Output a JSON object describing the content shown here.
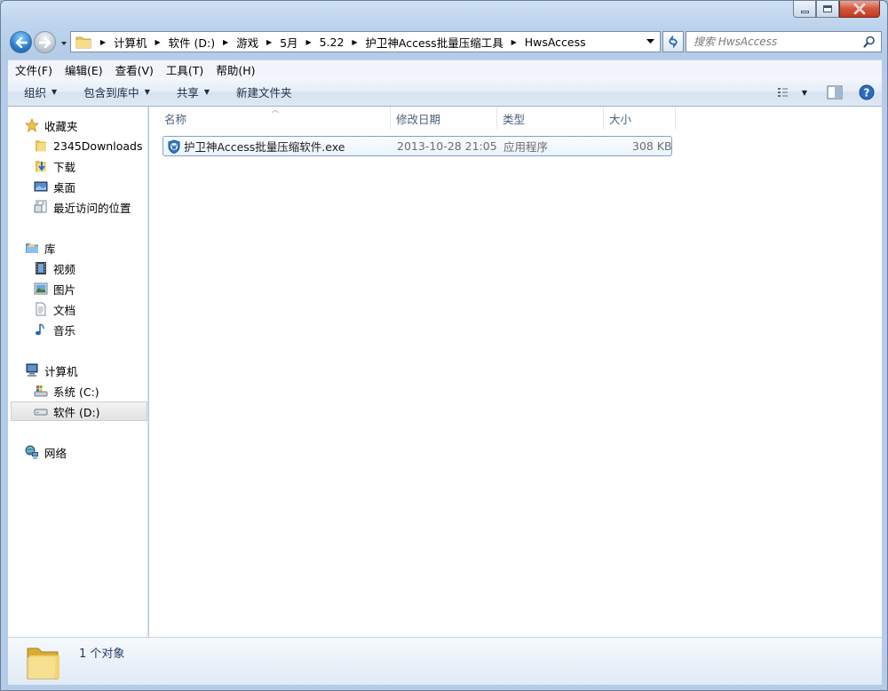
{
  "window": {
    "controls": {
      "minimize": "minimize",
      "maximize": "maximize",
      "close": "close"
    }
  },
  "address": {
    "segments": [
      "计算机",
      "软件 (D:)",
      "游戏",
      "5月",
      "5.22",
      "护卫神Access批量压缩工具",
      "HwsAccess"
    ]
  },
  "search": {
    "placeholder": "搜索 HwsAccess"
  },
  "menubar": {
    "items": [
      "文件(F)",
      "编辑(E)",
      "查看(V)",
      "工具(T)",
      "帮助(H)"
    ]
  },
  "toolbar": {
    "organize": "组织",
    "include_library": "包含到库中",
    "share": "共享",
    "new_folder": "新建文件夹"
  },
  "navpane": {
    "favorites": "收藏夹",
    "favorites_items": [
      "2345Downloads",
      "下载",
      "桌面",
      "最近访问的位置"
    ],
    "libraries": "库",
    "libraries_items": [
      "视频",
      "图片",
      "文档",
      "音乐"
    ],
    "computer": "计算机",
    "computer_items": [
      "系统 (C:)",
      "软件 (D:)"
    ],
    "network": "网络",
    "selected": "软件 (D:)"
  },
  "columns": {
    "name": "名称",
    "modified": "修改日期",
    "type": "类型",
    "size": "大小"
  },
  "files": [
    {
      "name": "护卫神Access批量压缩软件.exe",
      "modified": "2013-10-28 21:05",
      "type": "应用程序",
      "size": "308 KB"
    }
  ],
  "details": {
    "count_text": "1 个对象"
  },
  "colors": {
    "accent": "#7da2ce",
    "frame": "#b4cce8",
    "close": "#c03a21"
  }
}
